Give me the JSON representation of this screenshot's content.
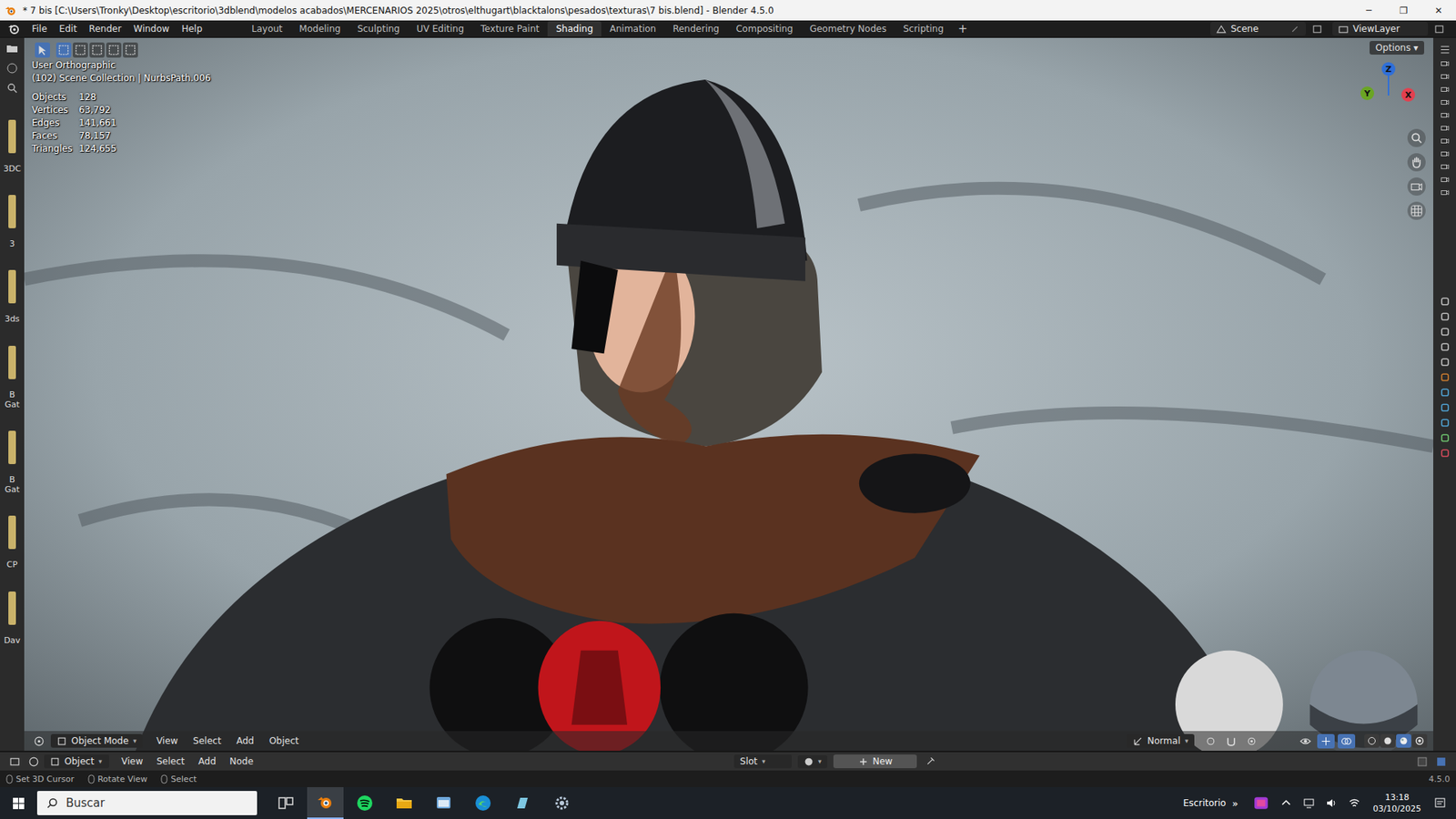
{
  "window": {
    "title": "* 7 bis [C:\\Users\\Tronky\\Desktop\\escritorio\\3dblend\\modelos acabados\\MERCENARIOS 2025\\otros\\elthugart\\blacktalons\\pesados\\texturas\\7 bis.blend] - Blender 4.5.0",
    "controls": [
      "─",
      "❐",
      "✕"
    ]
  },
  "menu": [
    "File",
    "Edit",
    "Render",
    "Window",
    "Help"
  ],
  "workspaces": [
    {
      "label": "Layout",
      "selected": false
    },
    {
      "label": "Modeling",
      "selected": false
    },
    {
      "label": "Sculpting",
      "selected": false
    },
    {
      "label": "UV Editing",
      "selected": false
    },
    {
      "label": "Texture Paint",
      "selected": false
    },
    {
      "label": "Shading",
      "selected": true
    },
    {
      "label": "Animation",
      "selected": false
    },
    {
      "label": "Rendering",
      "selected": false
    },
    {
      "label": "Compositing",
      "selected": false
    },
    {
      "label": "Geometry Nodes",
      "selected": false
    },
    {
      "label": "Scripting",
      "selected": false
    }
  ],
  "add_workspace": "+",
  "scene": "Scene",
  "view_layer": "ViewLayer",
  "file_strip": [
    "3DC",
    "3",
    "3ds",
    "B Gat",
    "B Gat",
    "CP",
    "Dav"
  ],
  "viewport": {
    "view_name": "User Orthographic",
    "collection": "(102) Scene Collection | NurbsPath.006",
    "stats": [
      {
        "label": "Objects",
        "value": "128"
      },
      {
        "label": "Vertices",
        "value": "63,792"
      },
      {
        "label": "Edges",
        "value": "141,661"
      },
      {
        "label": "Faces",
        "value": "78,157"
      },
      {
        "label": "Triangles",
        "value": "124,655"
      }
    ],
    "options": "Options",
    "gizmo": [
      {
        "label": "Z",
        "color": "#2f6fd8"
      },
      {
        "label": "Y",
        "color": "#6aa524"
      },
      {
        "label": "X",
        "color": "#e3404f"
      }
    ],
    "select_modes": [
      {
        "selected": true
      },
      {
        "selected": false
      },
      {
        "selected": false
      },
      {
        "selected": false
      },
      {
        "selected": false
      }
    ]
  },
  "header": {
    "mode": "Object Mode",
    "menus": [
      "View",
      "Select",
      "Add",
      "Object"
    ],
    "orientation": "Normal",
    "shading_modes": [
      {
        "kind": "wireframe",
        "selected": false
      },
      {
        "kind": "solid",
        "selected": false
      },
      {
        "kind": "material",
        "selected": true
      },
      {
        "kind": "rendered",
        "selected": false
      }
    ]
  },
  "node_header": {
    "type": "Object",
    "menus": [
      "View",
      "Select",
      "Add",
      "Node"
    ],
    "slot": "Slot",
    "new": "New"
  },
  "status_bar": {
    "hints": [
      "Set 3D Cursor",
      "Rotate View",
      "Select"
    ],
    "version": "4.5.0"
  },
  "taskbar": {
    "search": "Buscar",
    "desktop": "Escritorio",
    "chevron": "»",
    "time": "13:18",
    "date": "03/10/2025",
    "apps": [
      {
        "kind": "taskview",
        "active": false
      },
      {
        "kind": "blender",
        "active": true
      },
      {
        "kind": "spotify",
        "active": false
      },
      {
        "kind": "folder",
        "active": false
      },
      {
        "kind": "window",
        "active": false
      },
      {
        "kind": "edge",
        "active": false
      },
      {
        "kind": "notes",
        "active": false
      },
      {
        "kind": "gear",
        "active": false
      }
    ]
  }
}
